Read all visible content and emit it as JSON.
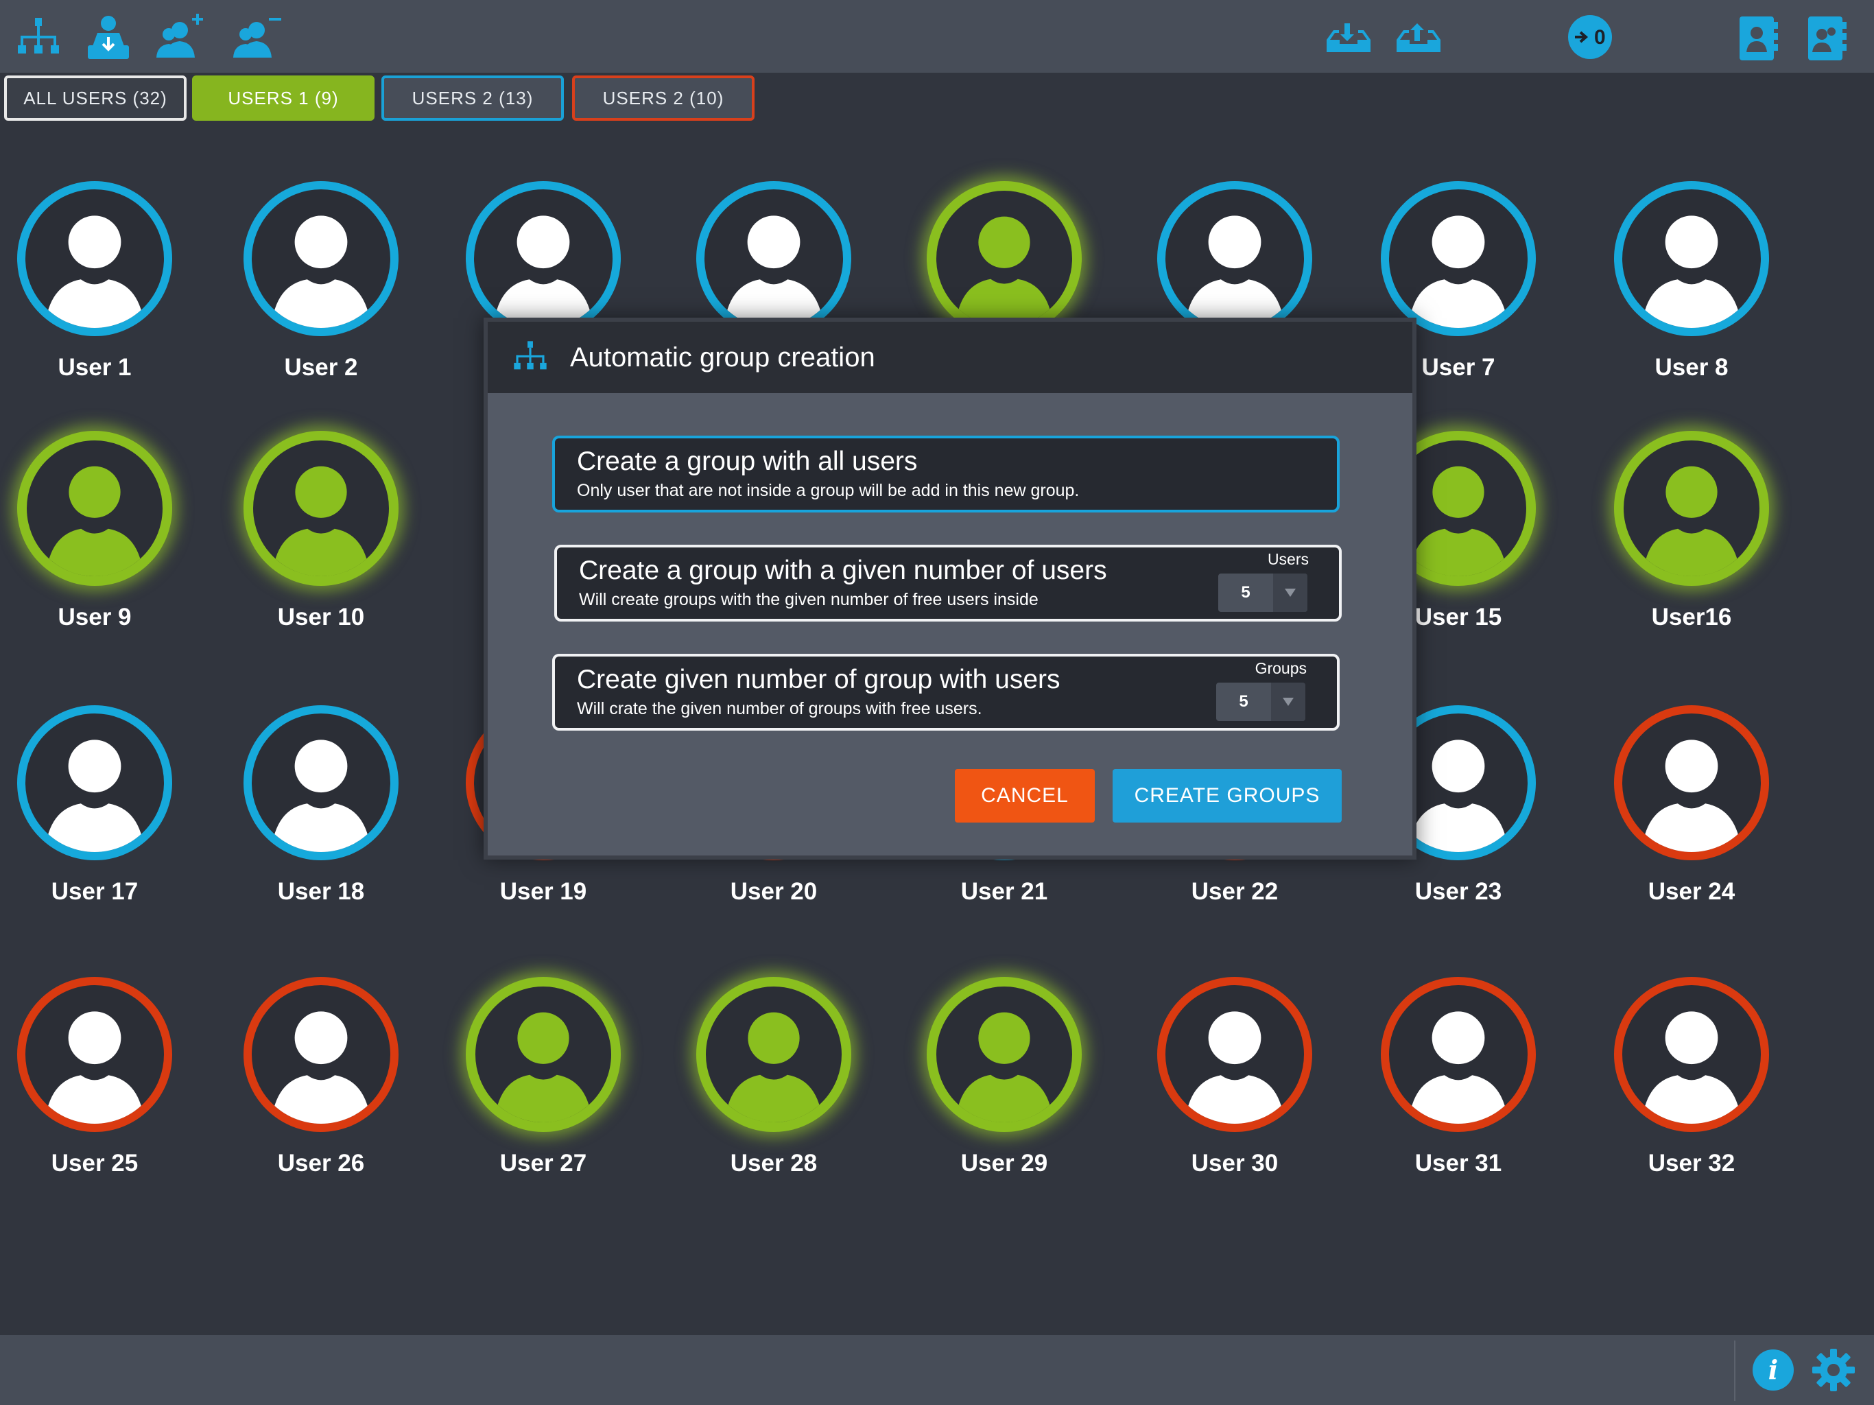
{
  "toolbar": {
    "icons": [
      "hierarchy-icon",
      "user-download-icon",
      "add-user-icon",
      "remove-user-icon",
      "tray-download-icon",
      "tray-upload-icon",
      "login-zero-icon",
      "address-book-icon",
      "address-book-alt-icon"
    ],
    "badge_text": "0"
  },
  "tabs": [
    {
      "label": "ALL USERS (32)",
      "style": "default"
    },
    {
      "label": "USERS 1 (9)",
      "style": "green"
    },
    {
      "label": "USERS 2 (13)",
      "style": "blue"
    },
    {
      "label": "USERS 2 (10)",
      "style": "red"
    }
  ],
  "colors": {
    "blue": "#16a9db",
    "green": "#8abf1f",
    "red": "#da3a10",
    "background": "#31353e",
    "bar": "#474d58"
  },
  "users": [
    {
      "name": "User 1",
      "color": "blue"
    },
    {
      "name": "User 2",
      "color": "blue"
    },
    {
      "name": "",
      "color": "blue"
    },
    {
      "name": "",
      "color": "blue"
    },
    {
      "name": "",
      "color": "green"
    },
    {
      "name": "",
      "color": "blue"
    },
    {
      "name": "User 7",
      "color": "blue"
    },
    {
      "name": "User 8",
      "color": "blue"
    },
    {
      "name": "User 9",
      "color": "green"
    },
    {
      "name": "User 10",
      "color": "green"
    },
    {
      "name": "User 15",
      "color": "green"
    },
    {
      "name": "User16",
      "color": "green"
    },
    {
      "name": "User 17",
      "color": "blue"
    },
    {
      "name": "User 18",
      "color": "blue"
    },
    {
      "name": "User 19",
      "color": "red"
    },
    {
      "name": "User 20",
      "color": "red"
    },
    {
      "name": "User 21",
      "color": "blue"
    },
    {
      "name": "User 22",
      "color": "red"
    },
    {
      "name": "User 23",
      "color": "blue"
    },
    {
      "name": "User 24",
      "color": "red"
    },
    {
      "name": "User 25",
      "color": "red"
    },
    {
      "name": "User 26",
      "color": "red"
    },
    {
      "name": "User 27",
      "color": "green"
    },
    {
      "name": "User 28",
      "color": "green"
    },
    {
      "name": "User 29",
      "color": "green"
    },
    {
      "name": "User 30",
      "color": "red"
    },
    {
      "name": "User 31",
      "color": "red"
    },
    {
      "name": "User 32",
      "color": "red"
    }
  ],
  "modal": {
    "title": "Automatic group creation",
    "icon": "hierarchy-icon",
    "options": [
      {
        "title": "Create a group with all users",
        "desc": "Only user that are not inside a group will be add in this new group.",
        "selected": true
      },
      {
        "title": "Create a group with a given number of users",
        "desc": "Will create groups with the given number of free users inside",
        "stepper_label": "Users",
        "stepper_value": "5"
      },
      {
        "title": "Create given number of group with users",
        "desc": "Will crate the given number of groups with free users.",
        "stepper_label": "Groups",
        "stepper_value": "5"
      }
    ],
    "cancel_label": "CANCEL",
    "create_label": "CREATE GROUPS"
  },
  "bottombar": {
    "icons": [
      "info-icon",
      "gear-icon"
    ],
    "info_glyph": "i"
  }
}
